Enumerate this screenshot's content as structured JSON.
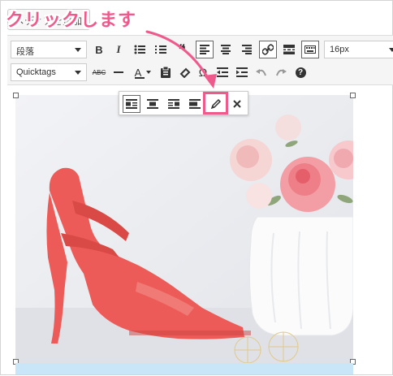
{
  "add_media": {
    "label": "メディアを追加"
  },
  "callout": {
    "text": "クリックします"
  },
  "toolbar": {
    "format_select": "段落",
    "font_family_select": "Quicktags",
    "font_size_select": "16px",
    "bold": "B",
    "italic": "I",
    "strike": "ABC",
    "text_color": "A",
    "special_char": "Ω",
    "help": "?"
  },
  "image_toolbar": {
    "buttons": [
      "align-left",
      "align-center",
      "align-right",
      "align-none",
      "edit",
      "remove"
    ]
  },
  "colors": {
    "accent": "#ef5a8c",
    "shoe": "#ec5b57",
    "highlight_bar": "#c9e6f9"
  }
}
